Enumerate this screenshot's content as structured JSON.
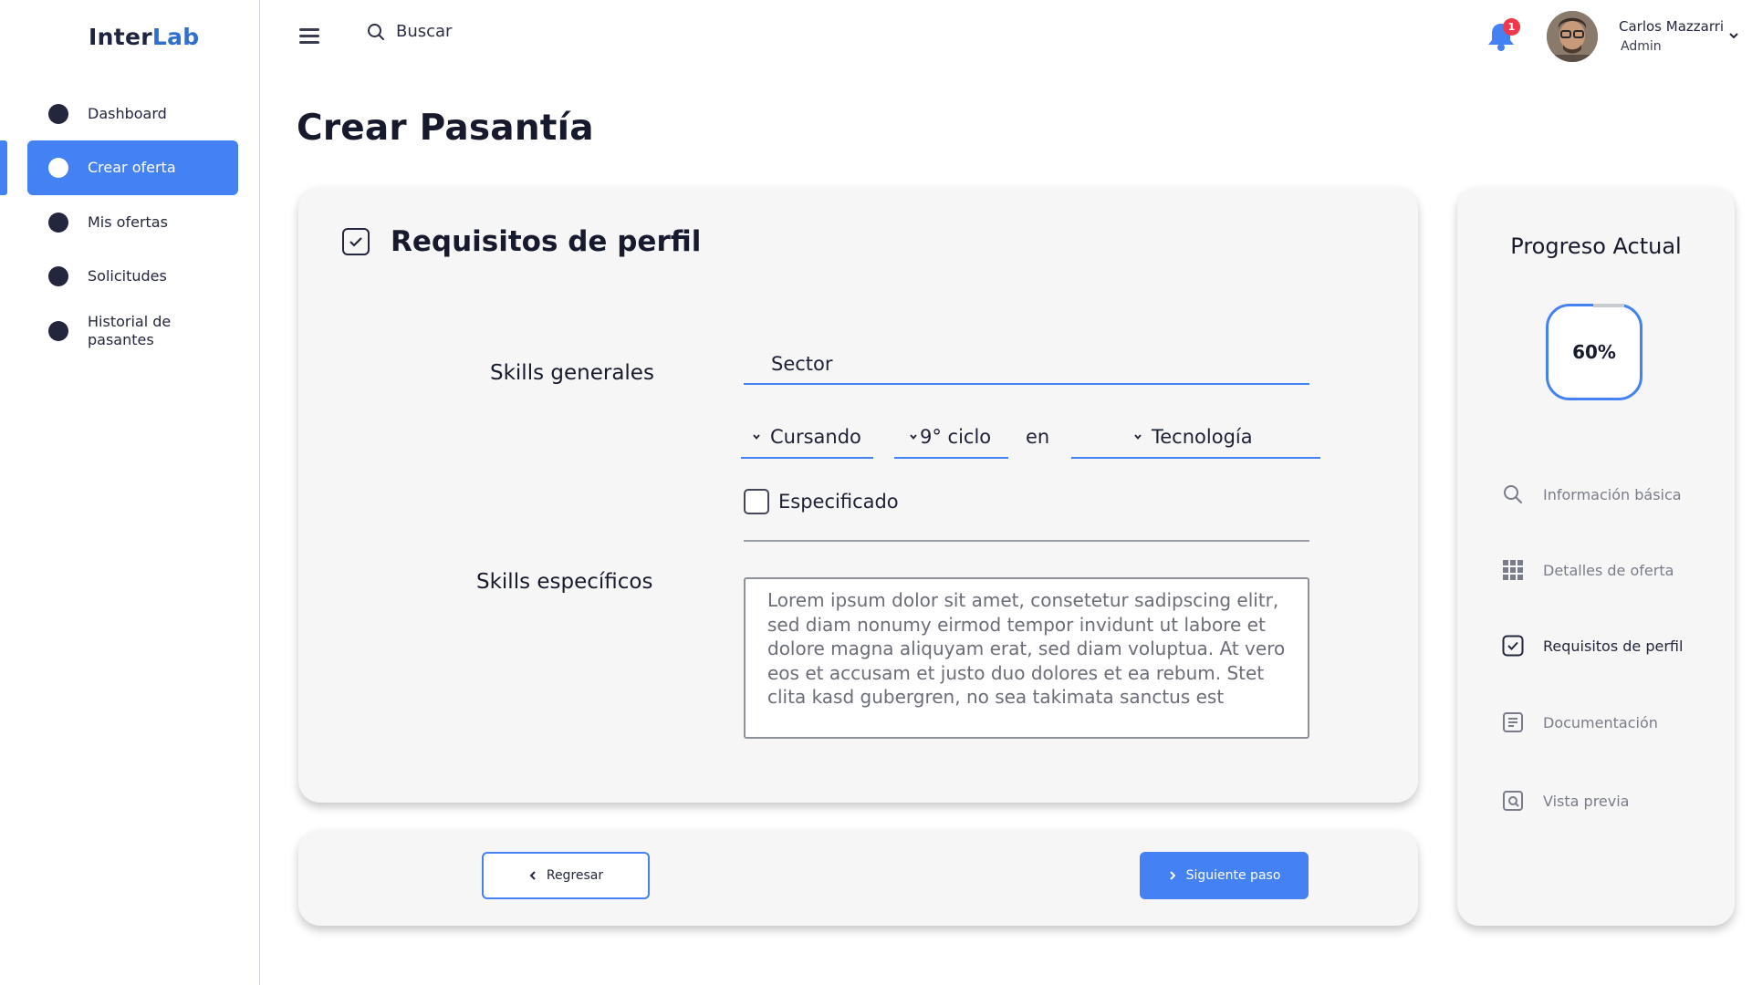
{
  "app": {
    "logo_part1": "Inter",
    "logo_part2": "Lab"
  },
  "sidebar": {
    "items": [
      {
        "label": "Dashboard",
        "active": false
      },
      {
        "label": "Crear oferta",
        "active": true
      },
      {
        "label": "Mis ofertas",
        "active": false
      },
      {
        "label": "Solicitudes",
        "active": false
      },
      {
        "label": "Historial de pasantes",
        "active": false
      }
    ]
  },
  "header": {
    "search_label": "Buscar",
    "notification_count": "1",
    "user_name": "Carlos Mazzarri",
    "user_role": "Admin"
  },
  "page": {
    "title": "Crear Pasantía"
  },
  "form": {
    "section_title": "Requisitos de perfil",
    "skills_generales_label": "Skills generales",
    "sector_value": "Sector",
    "status_value": "Cursando",
    "ciclo_value": "9° ciclo",
    "connector_text": "en",
    "area_value": "Tecnología",
    "especificado_label": "Especificado",
    "especificado_checked": false,
    "skills_especificos_label": "Skills específicos",
    "skills_especificos_text": "Lorem ipsum dolor sit amet, consetetur sadipscing elitr, sed diam nonumy eirmod tempor invidunt ut labore et dolore magna aliquyam erat, sed diam voluptua. At vero eos et accusam et justo duo dolores et ea rebum. Stet clita kasd gubergren, no sea takimata sanctus est"
  },
  "navigation": {
    "back_label": "Regresar",
    "next_label": "Siguiente paso"
  },
  "progress": {
    "title": "Progreso Actual",
    "percent_label": "60%",
    "percent_value": 0.6,
    "steps": [
      {
        "label": "Información básica",
        "icon": "search-icon"
      },
      {
        "label": "Detalles de oferta",
        "icon": "grid-icon"
      },
      {
        "label": "Requisitos de perfil",
        "icon": "checkbox-icon"
      },
      {
        "label": "Documentación",
        "icon": "document-icon"
      },
      {
        "label": "Vista previa",
        "icon": "preview-icon"
      }
    ],
    "current_step": 2
  },
  "colors": {
    "accent": "#4481f3",
    "text_dark": "#171a2d",
    "muted": "#7a7d89",
    "notification": "#f0384b",
    "card_bg": "#f6f6f7"
  }
}
